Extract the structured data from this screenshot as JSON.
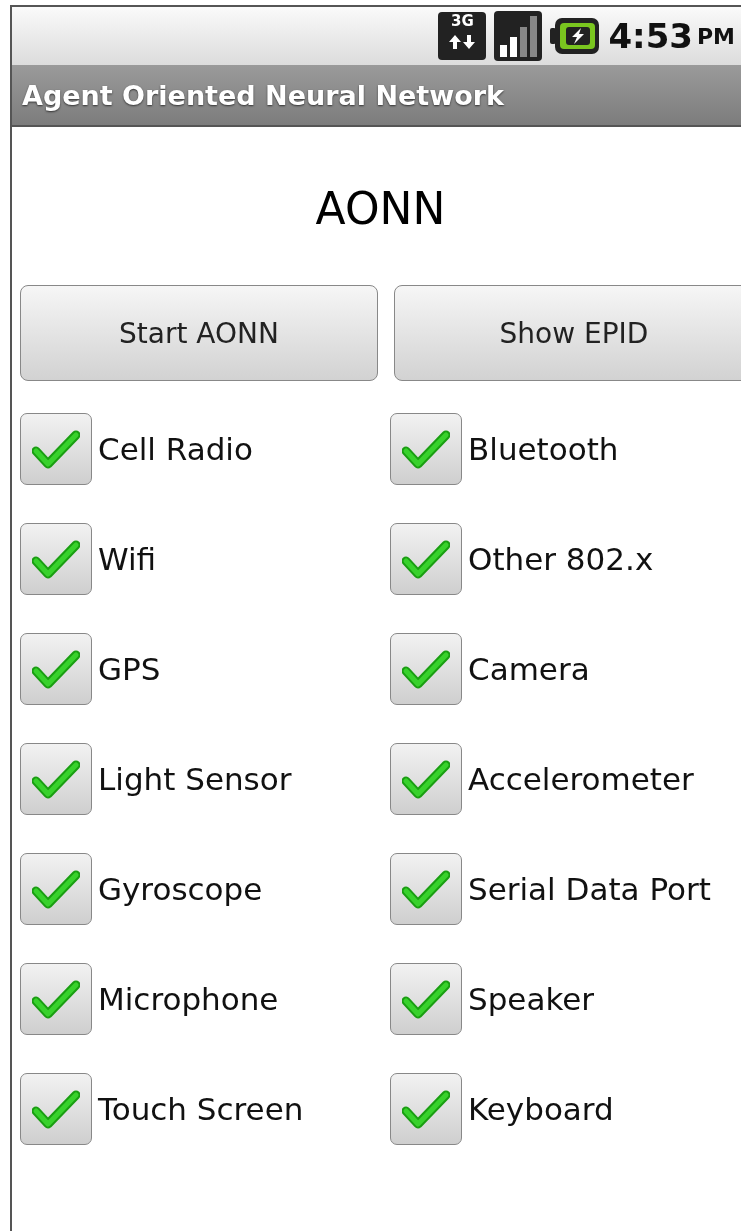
{
  "status_bar": {
    "network": "3G",
    "time": "4:53",
    "ampm": "PM"
  },
  "title_bar": {
    "title": "Agent Oriented Neural Network"
  },
  "heading": "AONN",
  "buttons": [
    "Start AONN",
    "Show EPID"
  ],
  "checkboxes": [
    {
      "label": "Cell Radio",
      "checked": true
    },
    {
      "label": "Bluetooth",
      "checked": true
    },
    {
      "label": "Wifi",
      "checked": true
    },
    {
      "label": "Other 802.x",
      "checked": true
    },
    {
      "label": "GPS",
      "checked": true
    },
    {
      "label": "Camera",
      "checked": true
    },
    {
      "label": "Light Sensor",
      "checked": true
    },
    {
      "label": "Accelerometer",
      "checked": true
    },
    {
      "label": "Gyroscope",
      "checked": true
    },
    {
      "label": "Serial Data Port",
      "checked": true
    },
    {
      "label": "Microphone",
      "checked": true
    },
    {
      "label": "Speaker",
      "checked": true
    },
    {
      "label": "Touch Screen",
      "checked": true
    },
    {
      "label": "Keyboard",
      "checked": true
    }
  ]
}
